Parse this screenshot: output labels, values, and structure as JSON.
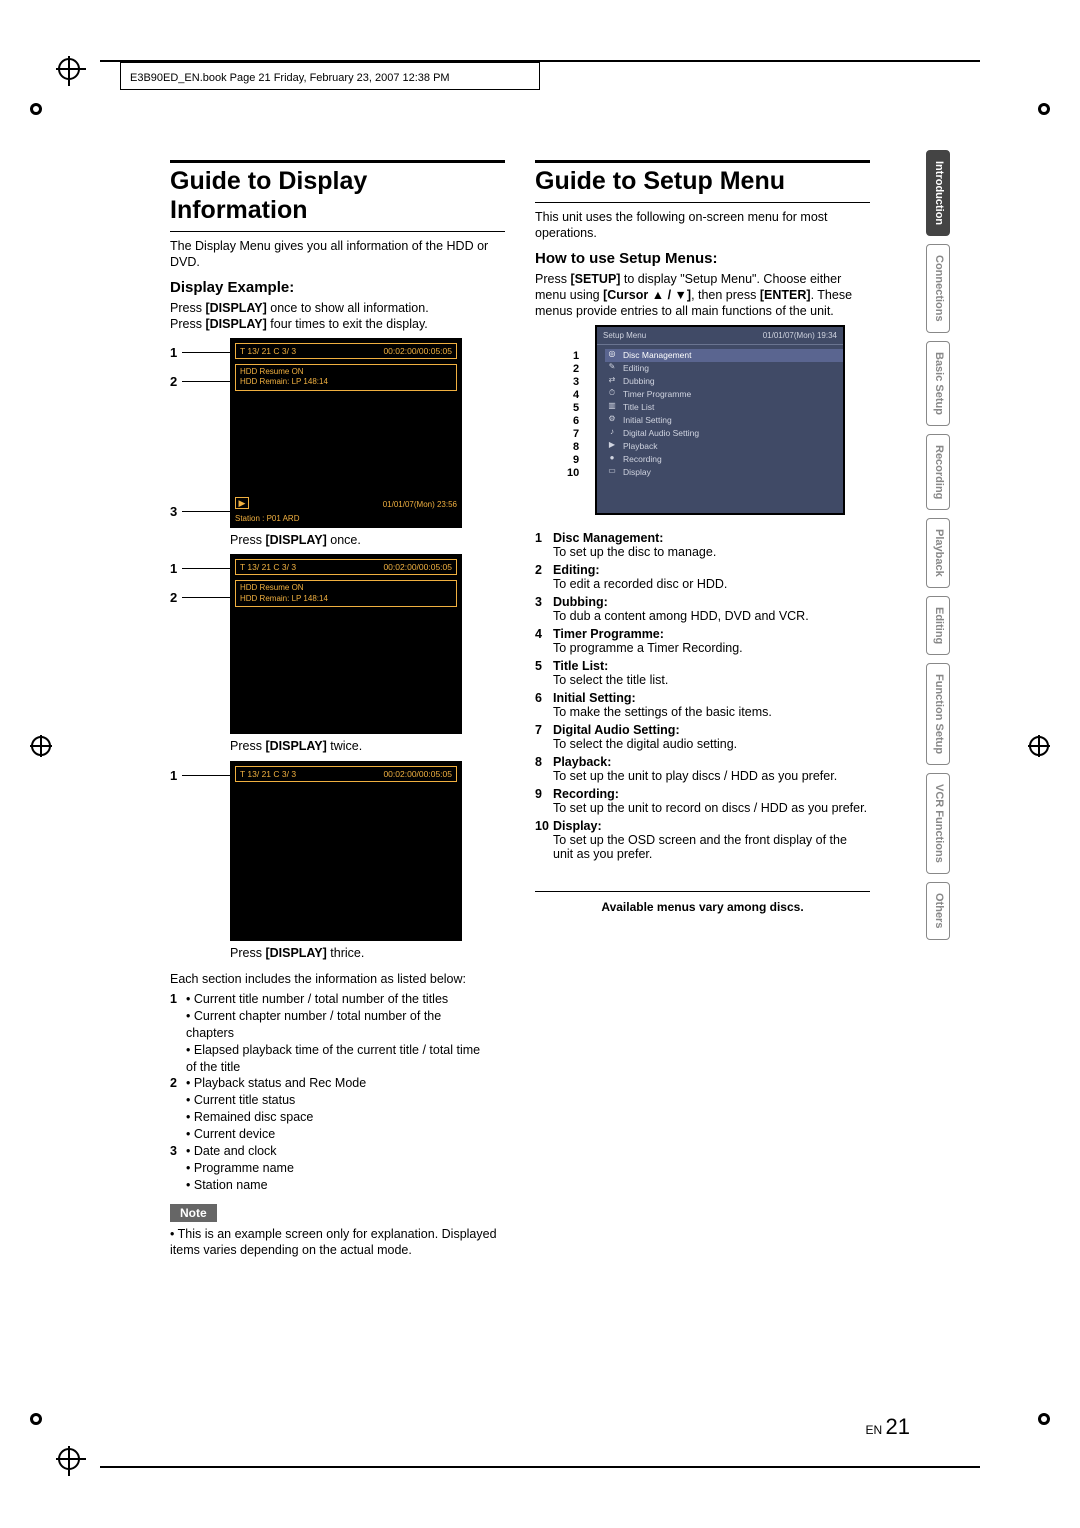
{
  "header_note": "E3B90ED_EN.book  Page 21  Friday, February 23, 2007  12:38 PM",
  "left": {
    "title": "Guide to Display Information",
    "intro": "The Display Menu gives you all information of the HDD or DVD.",
    "subtitle": "Display Example:",
    "para1a": "Press ",
    "para1b": "[DISPLAY]",
    "para1c": " once to show all information.",
    "para2a": "Press ",
    "para2b": "[DISPLAY]",
    "para2c": " four times to exit the display.",
    "tv_common": {
      "topbar_left": "T   13/  21   C   3/    3",
      "topbar_right": "00:02:00/00:05:05",
      "line1": "HDD Resume ON",
      "line2": "HDD Remain: LP 148:14",
      "botdate": "01/01/07(Mon) 23:56",
      "bot_station": "Station : P01  ARD"
    },
    "cap1a": "Press ",
    "cap1b": "[DISPLAY]",
    "cap1c": " once.",
    "cap2a": "Press ",
    "cap2b": "[DISPLAY]",
    "cap2c": " twice.",
    "cap3a": "Press ",
    "cap3b": "[DISPLAY]",
    "cap3c": " thrice.",
    "desc_lead": "Each section includes the information as listed below:",
    "desc": [
      {
        "n": "1",
        "items": [
          "Current title number / total number of the titles",
          "Current chapter number / total number of the chapters",
          "Elapsed playback time of the current title / total time of the title"
        ]
      },
      {
        "n": "2",
        "items": [
          "Playback status and Rec Mode",
          "Current title status",
          "Remained disc space",
          "Current device"
        ]
      },
      {
        "n": "3",
        "items": [
          "Date and clock",
          "Programme name",
          "Station name"
        ]
      }
    ],
    "note_label": "Note",
    "note_text": "This is an example screen only for explanation. Displayed items varies depending on the actual mode."
  },
  "right": {
    "title": "Guide to Setup Menu",
    "intro": "This unit uses the following on-screen menu for most operations.",
    "subtitle": "How to use Setup Menus:",
    "para_a": "Press ",
    "para_b": "[SETUP]",
    "para_c": " to display \"Setup Menu\". Choose either menu using ",
    "para_d": "[Cursor ▲ / ▼]",
    "para_e": ", then press ",
    "para_f": "[ENTER]",
    "para_g": ". These menus provide entries to all main functions of the unit.",
    "setup_hdr": "Setup Menu",
    "setup_date": "01/01/07(Mon)    19:34",
    "setup_items": [
      "Disc Management",
      "Editing",
      "Dubbing",
      "Timer Programme",
      "Title List",
      "Initial Setting",
      "Digital Audio Setting",
      "Playback",
      "Recording",
      "Display"
    ],
    "list": [
      {
        "n": "1",
        "t": "Disc Management:",
        "d": "To set up the disc to manage."
      },
      {
        "n": "2",
        "t": "Editing:",
        "d": "To edit a recorded disc or HDD."
      },
      {
        "n": "3",
        "t": "Dubbing:",
        "d": "To dub a content among HDD, DVD and VCR."
      },
      {
        "n": "4",
        "t": "Timer Programme:",
        "d": "To programme a Timer Recording."
      },
      {
        "n": "5",
        "t": "Title List:",
        "d": "To select the title list."
      },
      {
        "n": "6",
        "t": "Initial Setting:",
        "d": "To make the settings of the basic items."
      },
      {
        "n": "7",
        "t": "Digital Audio Setting:",
        "d": "To select the digital audio setting."
      },
      {
        "n": "8",
        "t": "Playback:",
        "d": "To set up the unit to play discs / HDD as you prefer."
      },
      {
        "n": "9",
        "t": "Recording:",
        "d": "To set up the unit to record on discs / HDD as you prefer."
      },
      {
        "n": "10",
        "t": "Display:",
        "d": "To set up the OSD screen and the front display of the unit as you prefer."
      }
    ],
    "availnote": "Available menus vary among discs."
  },
  "rtabs": [
    "Introduction",
    "Connections",
    "Basic Setup",
    "Recording",
    "Playback",
    "Editing",
    "Function Setup",
    "VCR Functions",
    "Others"
  ],
  "page_en": "EN",
  "page_no": "21"
}
